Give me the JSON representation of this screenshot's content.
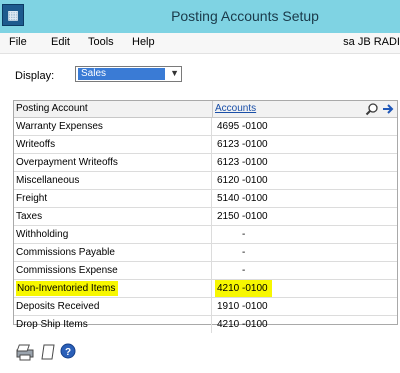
{
  "window": {
    "title": "Posting Accounts Setup"
  },
  "menu": {
    "items": [
      "File",
      "Edit",
      "Tools",
      "Help"
    ],
    "user_text": "sa  JB RADI"
  },
  "display": {
    "label": "Display:",
    "selected": "Sales"
  },
  "grid": {
    "header": {
      "posting_account": "Posting Account",
      "accounts": "Accounts"
    },
    "rows": [
      {
        "name": "Warranty Expenses",
        "account": "4695 -0100"
      },
      {
        "name": "Writeoffs",
        "account": "6123 -0100"
      },
      {
        "name": "Overpayment Writeoffs",
        "account": "6123 -0100"
      },
      {
        "name": "Miscellaneous",
        "account": "6120 -0100"
      },
      {
        "name": "Freight",
        "account": "5140 -0100"
      },
      {
        "name": "Taxes",
        "account": "2150 -0100"
      },
      {
        "name": "Withholding",
        "account": "-"
      },
      {
        "name": "Commissions Payable",
        "account": "-"
      },
      {
        "name": "Commissions Expense",
        "account": "-"
      },
      {
        "name": "Non-Inventoried Items",
        "account": "4210 -0100"
      },
      {
        "name": "Deposits Received",
        "account": "1910 -0100"
      },
      {
        "name": "Drop Ship Items",
        "account": "4210 -0100"
      }
    ]
  },
  "icons": {
    "app": "gp-app-icon",
    "lookup": "magnifier-icon",
    "go": "arrow-right-icon",
    "printer": "printer-icon",
    "note": "note-icon",
    "help": "help-icon"
  },
  "colors": {
    "titlebar": "#7fd3e3",
    "highlight": "#f7f700",
    "selection": "#3a7bd5"
  }
}
